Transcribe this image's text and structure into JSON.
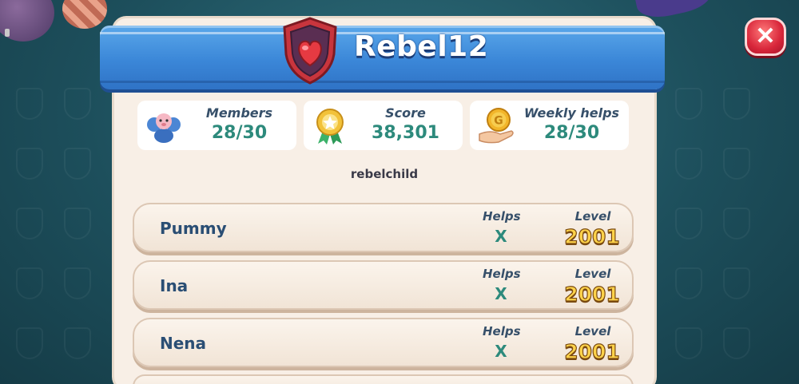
{
  "team": {
    "name": "Rebel12",
    "motto": "rebelchild"
  },
  "stats": [
    {
      "label": "Members",
      "value": "28/30",
      "icon": "members-icon"
    },
    {
      "label": "Score",
      "value": "38,301",
      "icon": "award-icon"
    },
    {
      "label": "Weekly helps",
      "value": "28/30",
      "icon": "coin-hand-icon"
    }
  ],
  "members": [
    {
      "name": "Pummy",
      "helps_label": "Helps",
      "helps": "X",
      "level_label": "Level",
      "level": "2001"
    },
    {
      "name": "Ina",
      "helps_label": "Helps",
      "helps": "X",
      "level_label": "Level",
      "level": "2001"
    },
    {
      "name": "Nena",
      "helps_label": "Helps",
      "helps": "X",
      "level_label": "Level",
      "level": "2001"
    }
  ],
  "close": {
    "label": "✕"
  },
  "colors": {
    "banner": "#3b87d8",
    "panel": "#f8efe6",
    "value_teal": "#2d8a7c",
    "level_gold": "#ffd34a",
    "close_red": "#d8263a"
  }
}
